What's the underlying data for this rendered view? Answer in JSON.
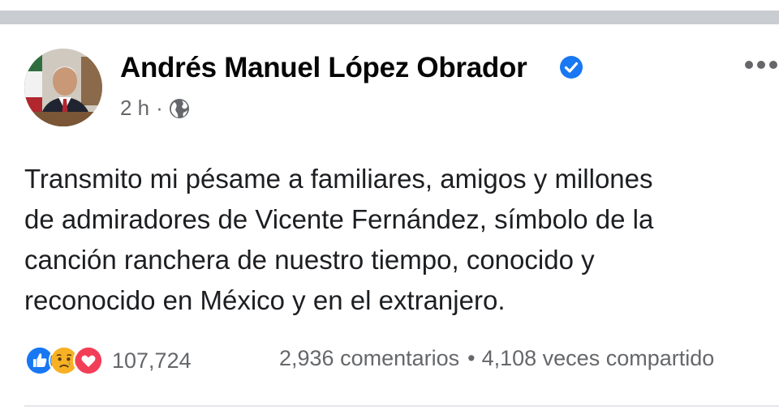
{
  "post": {
    "author": "Andrés Manuel López Obrador",
    "time": "2 h",
    "separator": "·",
    "audience_icon": "globe-icon",
    "verified_icon": "verified-badge-icon",
    "more_icon": "more-options-icon",
    "text_lines": [
      "Transmito mi pésame a familiares, amigos y millones",
      "de admiradores de Vicente Fernández, símbolo de la",
      "canción ranchera de nuestro tiempo, conocido y",
      "reconocido en México y en el extranjero."
    ]
  },
  "reactions": {
    "icons": [
      "like-icon",
      "sad-icon",
      "love-icon"
    ],
    "count": "107,724"
  },
  "stats": {
    "comments": "2,936 comentarios",
    "separator": "•",
    "shares": "4,108 veces compartido"
  },
  "colors": {
    "accent": "#1877f2",
    "secondary_text": "#65676b",
    "love": "#f33e58",
    "sad": "#f7b125",
    "top_bar": "#c9ccd1"
  }
}
